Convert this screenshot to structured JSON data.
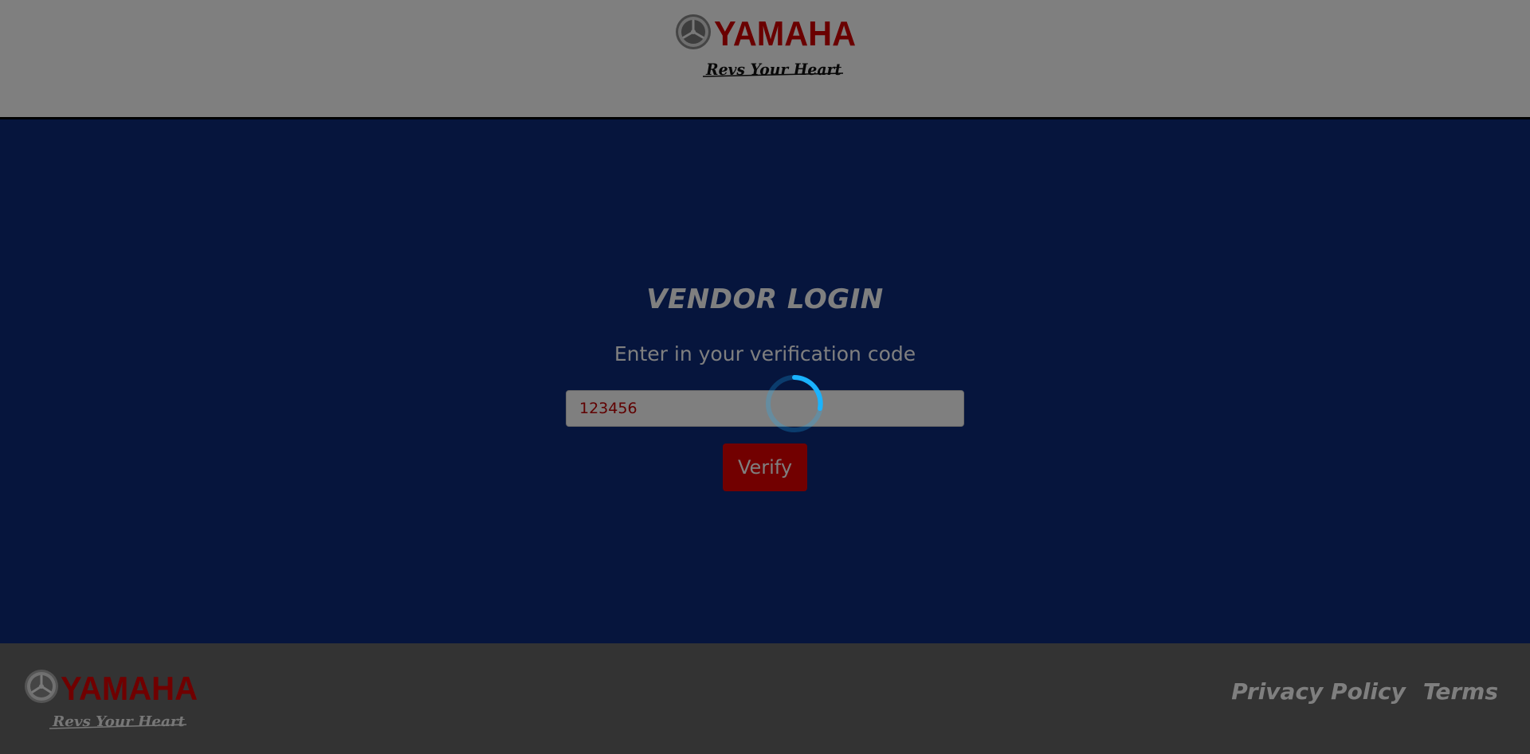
{
  "header": {
    "brand": "YAMAHA",
    "tagline": "Revs Your Heart"
  },
  "main": {
    "title": "VENDOR LOGIN",
    "subtitle": "Enter in your verification code",
    "code_field": {
      "value": "123456",
      "placeholder": ""
    },
    "verify_label": "Verify"
  },
  "footer": {
    "brand": "YAMAHA",
    "tagline": "Revs Your Heart",
    "privacy_label": "Privacy Policy",
    "terms_label": "Terms"
  },
  "colors": {
    "brand_red": "#e40000",
    "main_bg": "#0d2a7a",
    "footer_bg": "#666666",
    "spinner_accent": "#1ab3ff"
  },
  "icons": {
    "logo_emblem": "yamaha-tuning-forks-icon",
    "loading": "loading-spinner-icon"
  }
}
